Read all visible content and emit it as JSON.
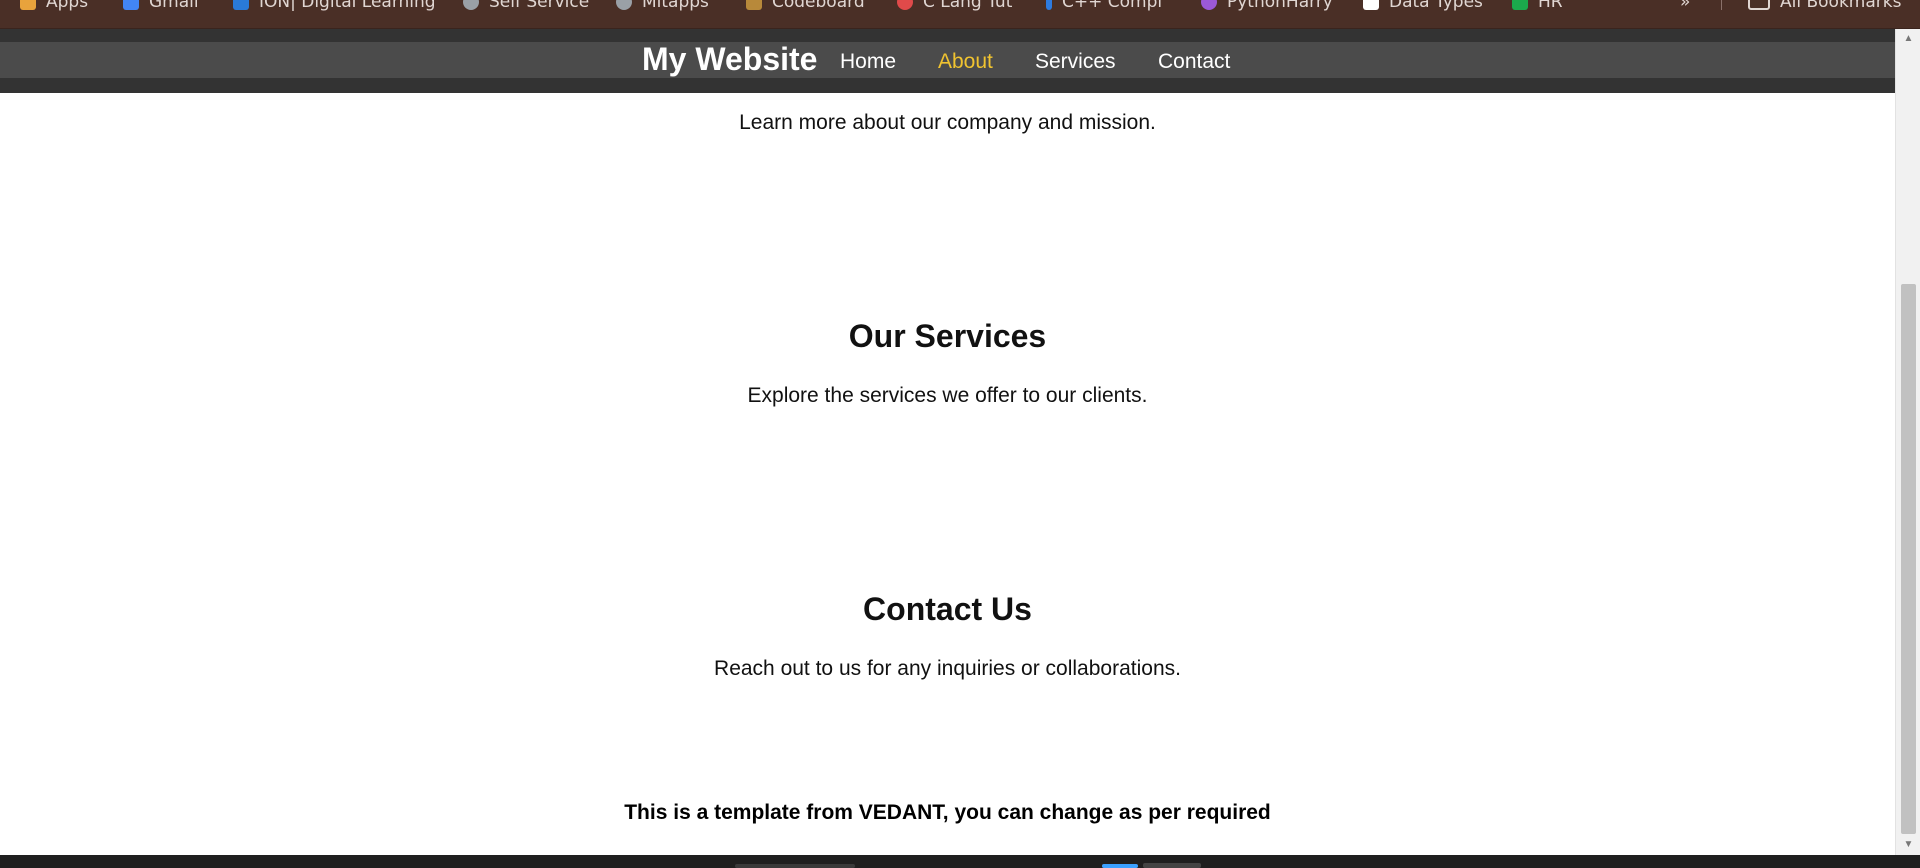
{
  "bookmarks": [
    {
      "label": "Apps",
      "icon": "apps-grid-icon",
      "color": "#e8a33c"
    },
    {
      "label": "Gmail",
      "icon": "gmail-icon",
      "color": "#4285f4"
    },
    {
      "label": "ION| Digital Learning",
      "icon": "ion-icon",
      "color": "#2a7ad8"
    },
    {
      "label": "Self Service",
      "icon": "globe-icon",
      "color": "#9aa0a6"
    },
    {
      "label": "Mitapps",
      "icon": "globe-icon",
      "color": "#9aa0a6"
    },
    {
      "label": "Codeboard",
      "icon": "folder-icon",
      "color": "#b8893a"
    },
    {
      "label": "C Lang Tut",
      "icon": "tutorial-icon",
      "color": "#e04a4a"
    },
    {
      "label": "C++ Compi",
      "icon": "compiler-icon",
      "color": "#2d7be0"
    },
    {
      "label": "PythonHarry",
      "icon": "python-icon",
      "color": "#9b59d8"
    },
    {
      "label": "Data Types",
      "icon": "checkbox-icon",
      "color": "#ffffff"
    },
    {
      "label": "HR",
      "icon": "hackerrank-icon",
      "color": "#1ba94c"
    }
  ],
  "bookmarks_overflow": "»",
  "all_bookmarks": "All Bookmarks",
  "site": {
    "brand": "My Website",
    "nav": [
      "Home",
      "About",
      "Services",
      "Contact"
    ],
    "active_nav": "About",
    "accent": "#f0c330"
  },
  "sections": {
    "about_text": "Learn more about our company and mission.",
    "services_heading": "Our Services",
    "services_text": "Explore the services we offer to our clients.",
    "contact_heading": "Contact Us",
    "contact_text": "Reach out to us for any inquiries or collaborations."
  },
  "footer": "This is a template from VEDANT, you can change as per required"
}
